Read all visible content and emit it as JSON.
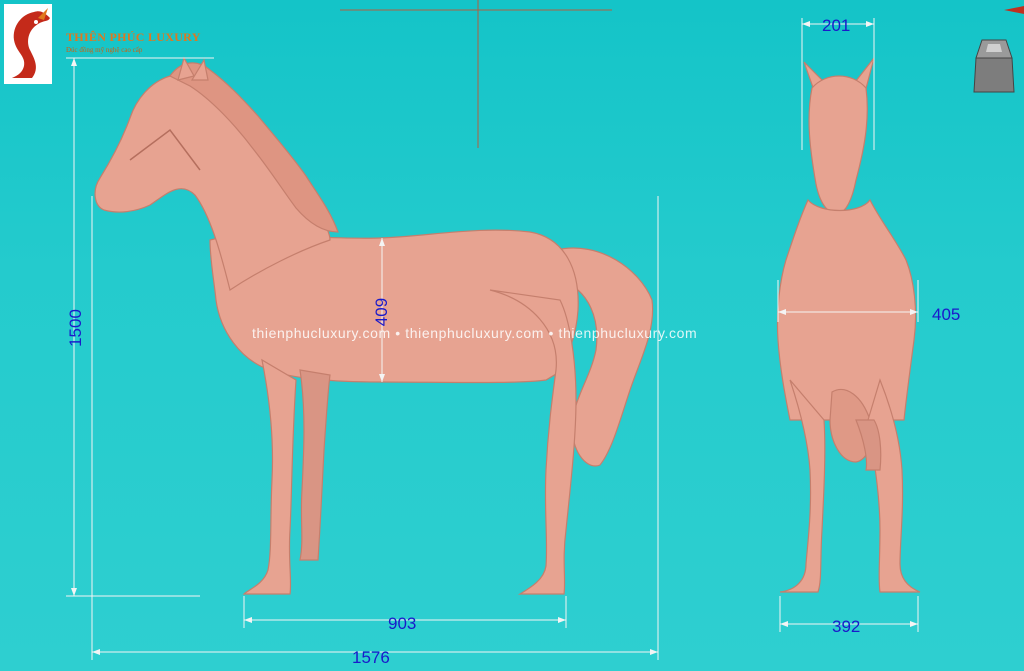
{
  "brand": {
    "name": "THIÊN PHÚC LUXURY",
    "tagline": "Đúc đồng mỹ nghệ cao cấp"
  },
  "watermark": "thienphucluxury.com • thienphucluxury.com • thienphucluxury.com",
  "dimensions": {
    "side_total_height": "1500",
    "side_body_depth": "409",
    "side_leg_span": "903",
    "side_total_length": "1576",
    "front_head_width": "201",
    "front_body_width": "405",
    "front_leg_width": "392"
  },
  "icons": {
    "view_cube": "view-cube-icon",
    "logo": "dragon-logo-icon"
  },
  "colors": {
    "background": "#22c9cc",
    "horse": "#e7a391",
    "dimension": "#1a1acb"
  }
}
